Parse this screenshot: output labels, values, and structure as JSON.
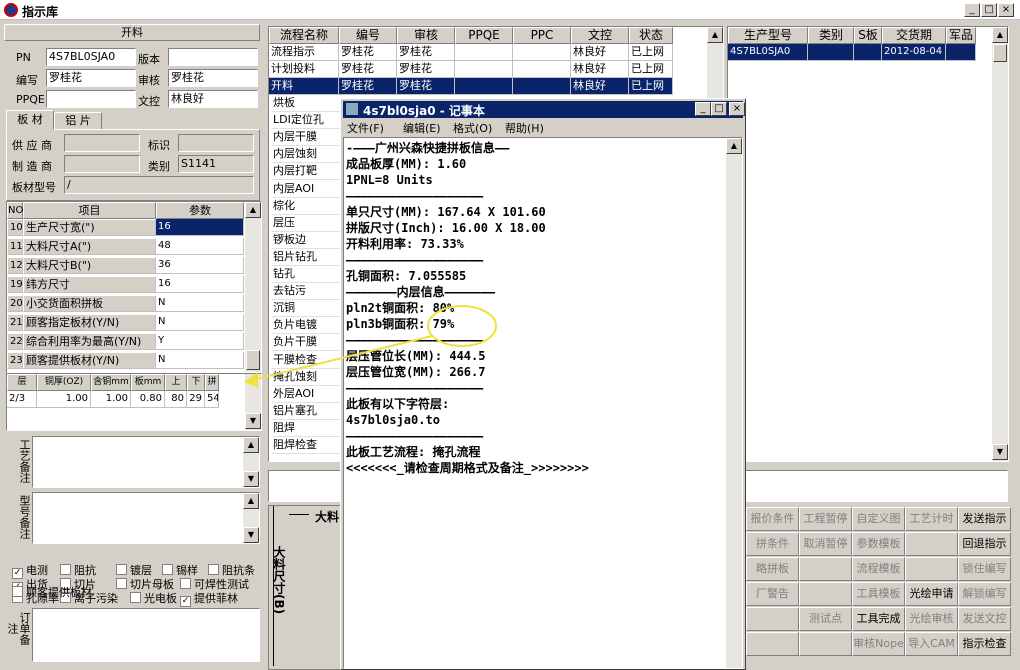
{
  "window": {
    "title": "指示库"
  },
  "left": {
    "section_title": "开料",
    "pn_label": "PN",
    "pn_value": "4S7BL0SJA0",
    "version_label": "版本",
    "version_value": "",
    "author_label": "编写",
    "author_value": "罗桂花",
    "review_label": "审核",
    "review_value": "罗桂花",
    "ppqe_label": "PPQE",
    "ppqe_value": "",
    "doccontrol_label": "文控",
    "doccontrol_value": "林良好",
    "tabs": [
      "板 材",
      "铝 片"
    ],
    "supplier_label": "供 应 商",
    "supplier_value": "",
    "mark_label": "标识",
    "mark_value": "",
    "maker_label": "制 造 商",
    "maker_value": "",
    "category_label": "类别",
    "category_value": "S1141",
    "boardtype_label": "板材型号",
    "boardtype_value": "/",
    "param_headers": [
      "NO",
      "项目",
      "参数"
    ],
    "params": [
      {
        "no": "10",
        "item": "生产尺寸宽(\")",
        "value": "16"
      },
      {
        "no": "11",
        "item": "大料尺寸A(\")",
        "value": "48"
      },
      {
        "no": "12",
        "item": "大料尺寸B(\")",
        "value": "36"
      },
      {
        "no": "19",
        "item": "纬方尺寸",
        "value": "16"
      },
      {
        "no": "20",
        "item": "小交货面积拼板",
        "value": "N"
      },
      {
        "no": "21",
        "item": "顾客指定板材(Y/N)",
        "value": "N"
      },
      {
        "no": "22",
        "item": "综合利用率为最高(Y/N)",
        "value": "Y"
      },
      {
        "no": "23",
        "item": "顾客提供板材(Y/N)",
        "value": "N"
      }
    ],
    "layer_headers": [
      "层",
      "铜厚(OZ)",
      "含铜mm",
      "板mm",
      "上",
      "下",
      "拼"
    ],
    "layer_row": [
      "2/3",
      "1.00",
      "1.00",
      "0.80",
      "80",
      "29",
      "54."
    ],
    "craft_remark_label": "工艺备注",
    "model_remark_label": "型号备注",
    "checks": [
      {
        "label": "电测",
        "checked": true
      },
      {
        "label": "阻抗",
        "checked": false
      },
      {
        "label": "镀层",
        "checked": false
      },
      {
        "label": "锡样",
        "checked": false
      },
      {
        "label": "阻抗条",
        "checked": false
      },
      {
        "label": "出货",
        "checked": true
      },
      {
        "label": "切片",
        "checked": false
      },
      {
        "label": "切片母板",
        "checked": false
      },
      {
        "label": "可焊性测试",
        "checked": false
      },
      {
        "label": "孔隙率",
        "checked": false
      },
      {
        "label": "离子污染",
        "checked": false
      },
      {
        "label": "光电板",
        "checked": false
      },
      {
        "label": "提供菲林",
        "checked": true
      },
      {
        "label": "顾客提供板材",
        "checked": false
      }
    ],
    "order_remark_label": "订单备注"
  },
  "flow": {
    "headers": [
      "流程名称",
      "编号",
      "审核",
      "PPQE",
      "PPC",
      "文控",
      "状态"
    ],
    "rows": [
      [
        "流程指示",
        "罗桂花",
        "罗桂花",
        "",
        "",
        "林良好",
        "已上网"
      ],
      [
        "计划投料",
        "罗桂花",
        "罗桂花",
        "",
        "",
        "林良好",
        "已上网"
      ],
      [
        "开料",
        "罗桂花",
        "罗桂花",
        "",
        "",
        "林良好",
        "已上网"
      ]
    ],
    "names": [
      "烘板",
      "LDI定位孔",
      "内层干膜",
      "内层蚀刻",
      "内层打靶",
      "内层AOI",
      "棕化",
      "层压",
      "锣板边",
      "铝片钻孔",
      "钻孔",
      "去钻污",
      "沉铜",
      "负片电镀",
      "负片干膜",
      "干膜检查",
      "掩孔蚀刻",
      "外层AOI",
      "铝片塞孔",
      "阻焊",
      "阻焊检查"
    ]
  },
  "right": {
    "headers": [
      "生产型号",
      "类别",
      "S板",
      "交货期",
      "军品"
    ],
    "row": [
      "4S7BL0SJA0",
      "",
      "",
      "2012-08-04",
      ""
    ]
  },
  "buttons": [
    [
      "报价条件",
      "工程暂停",
      "自定义图",
      "工艺计时",
      "发送指示"
    ],
    [
      "拼条件",
      "取消暂停",
      "参数模板",
      "",
      "回退指示"
    ],
    [
      "略拼板",
      "",
      "流程模板",
      "",
      "锁住编写"
    ],
    [
      "厂警告",
      "",
      "工具模板",
      "光绘申请",
      "解锁编写"
    ],
    [
      "",
      "测试点",
      "工具完成",
      "光绘审核",
      "发送文控"
    ],
    [
      "",
      "",
      "审核Nope",
      "导入CAM",
      "指示检查"
    ]
  ],
  "bigsize": {
    "a_label": "大料",
    "b_label": "大料尺寸(B)"
  },
  "notepad": {
    "title": "4s7bl0sja0 - 记事本",
    "menu": [
      "文件(F)",
      "编辑(E)",
      "格式(O)",
      "帮助(H)"
    ],
    "lines": [
      "-———广州兴森快捷拼板信息——",
      "成品板厚(MM): 1.60",
      "1PNL=8 Units",
      "———————————————————",
      "单只尺寸(MM): 167.64 X 101.60",
      "拼版尺寸(Inch): 16.00 X 18.00",
      "开料利用率: 73.33%",
      "———————————————————",
      "孔铜面积: 7.055585",
      "———————内层信息———————",
      "pln2t铜面积: 80%",
      "pln3b铜面积: 79%",
      "———————————————————",
      "层压管位长(MM): 444.5",
      "层压管位宽(MM): 266.7",
      "———————————————————",
      "此板有以下字符层:",
      "4s7bl0sja0.to",
      "———————————————————",
      "此板工艺流程: 掩孔流程",
      "<<<<<<<_请检查周期格式及备注_>>>>>>>>"
    ]
  },
  "colors": {
    "selection": "#0a246a",
    "annotation": "#f0e040",
    "face": "#d4d0c8"
  }
}
